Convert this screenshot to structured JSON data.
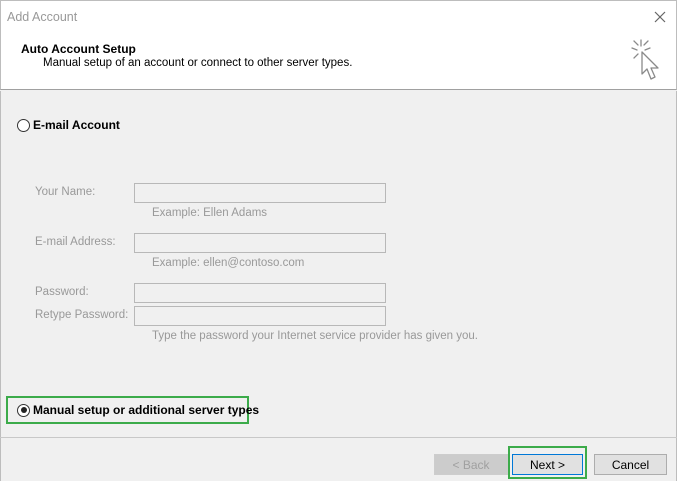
{
  "window": {
    "title": "Add Account"
  },
  "header": {
    "title": "Auto Account Setup",
    "subtitle": "Manual setup of an account or connect to other server types."
  },
  "options": {
    "email_account": {
      "label": "E-mail Account",
      "selected": false
    },
    "manual_setup": {
      "label": "Manual setup or additional server types",
      "selected": true
    }
  },
  "form": {
    "your_name": {
      "label": "Your Name:",
      "value": "",
      "hint": "Example: Ellen Adams"
    },
    "email_address": {
      "label": "E-mail Address:",
      "value": "",
      "hint": "Example: ellen@contoso.com"
    },
    "password": {
      "label": "Password:",
      "value": ""
    },
    "retype_password": {
      "label": "Retype Password:",
      "value": "",
      "hint": "Type the password your Internet service provider has given you."
    },
    "state": "disabled"
  },
  "buttons": {
    "back": {
      "label": "< Back",
      "enabled": false
    },
    "next": {
      "label": "Next >",
      "enabled": true
    },
    "cancel": {
      "label": "Cancel",
      "enabled": true
    }
  },
  "colors": {
    "highlight": "#3cab4a",
    "disabled_text": "#999999",
    "background": "#f0f0f0"
  },
  "icons": {
    "close": "close-icon",
    "wizard": "wizard-cursor-icon"
  }
}
